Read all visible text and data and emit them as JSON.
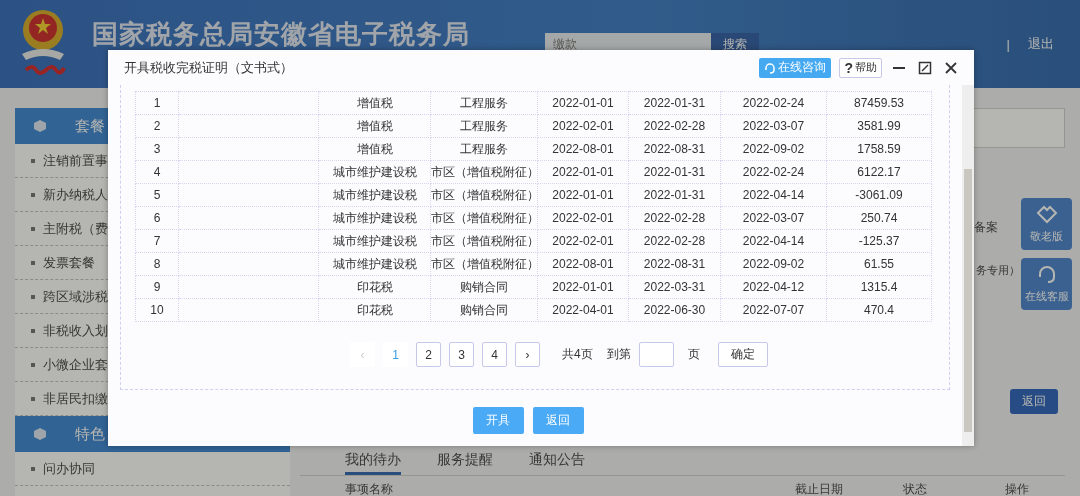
{
  "header": {
    "title": "国家税务总局安徽省电子税务局",
    "search_placeholder": "缴款",
    "search_button": "搜索",
    "divider": "|",
    "logout": "退出"
  },
  "sidebar": {
    "sections": [
      {
        "title": "套餐",
        "items": [
          "注销前置事",
          "新办纳税人",
          "主附税（费",
          "发票套餐",
          "跨区域涉税",
          "非税收入划",
          "小微企业套",
          "非居民扣缴"
        ]
      },
      {
        "title": "特色",
        "items": [
          "问办协同"
        ]
      }
    ]
  },
  "main": {
    "texts": [
      "备案",
      "务专用）"
    ],
    "back_button": "返回",
    "tabs": [
      {
        "label": "我的待办",
        "selected": true
      },
      {
        "label": "服务提醒",
        "selected": false
      },
      {
        "label": "通知公告",
        "selected": false
      }
    ],
    "columns": [
      "事项名称",
      "截止日期",
      "状态",
      "操作"
    ]
  },
  "float_buttons": [
    {
      "kind": "elder",
      "label": "敬老版"
    },
    {
      "kind": "service",
      "label": "在线客服"
    }
  ],
  "dialog": {
    "title": "开具税收完税证明（文书式）",
    "consult_button": "在线咨询",
    "help_mark": "?",
    "help_button": "帮助",
    "rows": [
      {
        "no": "1",
        "tax_type": "增值税",
        "item": "工程服务",
        "start": "2022-01-01",
        "end": "2022-01-31",
        "date": "2022-02-24",
        "amount": "87459.53"
      },
      {
        "no": "2",
        "tax_type": "增值税",
        "item": "工程服务",
        "start": "2022-02-01",
        "end": "2022-02-28",
        "date": "2022-03-07",
        "amount": "3581.99"
      },
      {
        "no": "3",
        "tax_type": "增值税",
        "item": "工程服务",
        "start": "2022-08-01",
        "end": "2022-08-31",
        "date": "2022-09-02",
        "amount": "1758.59"
      },
      {
        "no": "4",
        "tax_type": "城市维护建设税",
        "item": "市区（增值税附征）",
        "start": "2022-01-01",
        "end": "2022-01-31",
        "date": "2022-02-24",
        "amount": "6122.17"
      },
      {
        "no": "5",
        "tax_type": "城市维护建设税",
        "item": "市区（增值税附征）",
        "start": "2022-01-01",
        "end": "2022-01-31",
        "date": "2022-04-14",
        "amount": "-3061.09"
      },
      {
        "no": "6",
        "tax_type": "城市维护建设税",
        "item": "市区（增值税附征）",
        "start": "2022-02-01",
        "end": "2022-02-28",
        "date": "2022-03-07",
        "amount": "250.74"
      },
      {
        "no": "7",
        "tax_type": "城市维护建设税",
        "item": "市区（增值税附征）",
        "start": "2022-02-01",
        "end": "2022-02-28",
        "date": "2022-04-14",
        "amount": "-125.37"
      },
      {
        "no": "8",
        "tax_type": "城市维护建设税",
        "item": "市区（增值税附征）",
        "start": "2022-08-01",
        "end": "2022-08-31",
        "date": "2022-09-02",
        "amount": "61.55"
      },
      {
        "no": "9",
        "tax_type": "印花税",
        "item": "购销合同",
        "start": "2022-01-01",
        "end": "2022-03-31",
        "date": "2022-04-12",
        "amount": "1315.4"
      },
      {
        "no": "10",
        "tax_type": "印花税",
        "item": "购销合同",
        "start": "2022-04-01",
        "end": "2022-06-30",
        "date": "2022-07-07",
        "amount": "470.4"
      }
    ],
    "pagination": {
      "prev": "‹",
      "prev_disabled": true,
      "pages": [
        {
          "label": "1",
          "selected": true
        },
        {
          "label": "2",
          "selected": false
        },
        {
          "label": "3",
          "selected": false
        },
        {
          "label": "4",
          "selected": false
        }
      ],
      "next": "›",
      "total": "共4页",
      "goto": "到第",
      "unit": "页",
      "confirm": "确定"
    },
    "buttons": [
      "开具",
      "返回"
    ]
  }
}
